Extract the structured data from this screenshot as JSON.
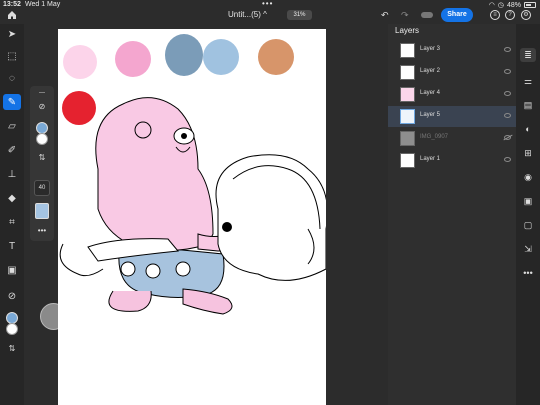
{
  "status": {
    "time": "13:52",
    "date": "Wed 1 May",
    "battery": "48%"
  },
  "toolbar": {
    "doc_title": "Untit...(5) ^",
    "zoom": "31%",
    "share_label": "Share"
  },
  "brush": {
    "size": "40",
    "color": "#a5c4e2"
  },
  "colors": {
    "fg": "#7aa9d6",
    "bg": "#ffffff",
    "accent": "#1473e6"
  },
  "layers_panel": {
    "title": "Layers",
    "layers": [
      {
        "name": "Layer 3",
        "selected": false,
        "visible": true
      },
      {
        "name": "Layer 2",
        "selected": false,
        "visible": true
      },
      {
        "name": "Layer 4",
        "selected": false,
        "visible": true
      },
      {
        "name": "Layer 5",
        "selected": true,
        "visible": true
      },
      {
        "name": "IMG_0907",
        "selected": false,
        "visible": false
      },
      {
        "name": "Layer 1",
        "selected": false,
        "visible": true
      }
    ]
  },
  "palette": [
    "#fcd4ea",
    "#f4a6cf",
    "#7b9cb8",
    "#a0c2e0",
    "#d7956a",
    "#e5222f"
  ]
}
